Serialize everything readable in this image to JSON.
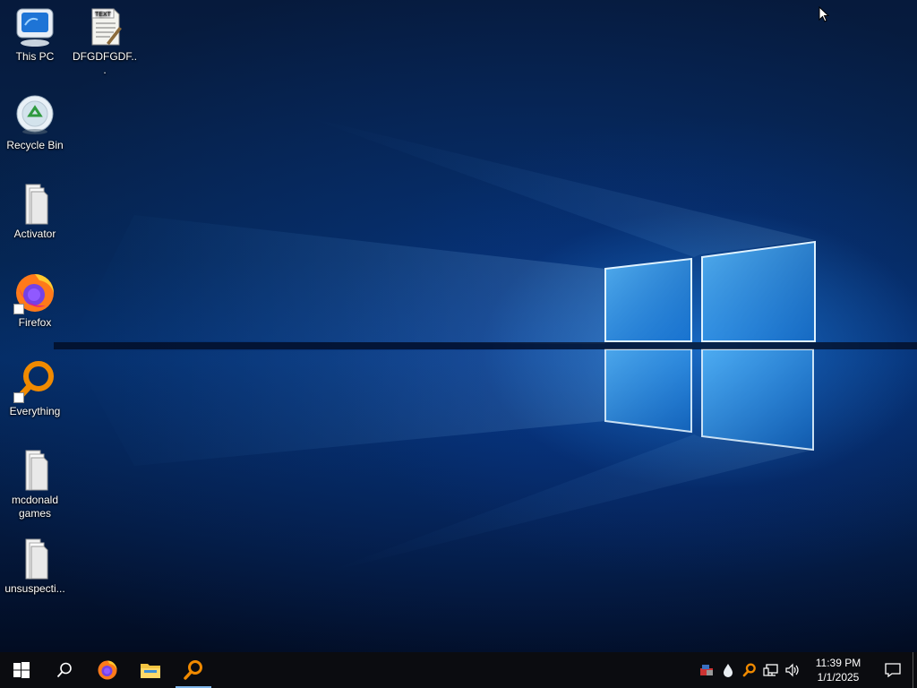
{
  "desktop": {
    "icons": [
      {
        "label": "This PC",
        "icon": "computer-icon"
      },
      {
        "label": "DFGDFGDF...",
        "icon": "text-document-icon",
        "badge": "TEXT"
      },
      {
        "label": "Recycle Bin",
        "icon": "recycle-bin-icon"
      },
      {
        "label": "Activator",
        "icon": "folder-icon"
      },
      {
        "label": "Firefox",
        "icon": "firefox-icon"
      },
      {
        "label": "Everything",
        "icon": "everything-search-icon"
      },
      {
        "label": "mcdonald games",
        "icon": "folder-icon"
      },
      {
        "label": "unsuspecti...",
        "icon": "folder-icon"
      }
    ]
  },
  "taskbar": {
    "pinned": [
      {
        "name": "start",
        "icon": "windows-logo-icon"
      },
      {
        "name": "search",
        "icon": "search-icon"
      },
      {
        "name": "firefox",
        "icon": "firefox-icon"
      },
      {
        "name": "file-explorer",
        "icon": "folder-icon"
      },
      {
        "name": "everything",
        "icon": "everything-search-icon",
        "active": true
      }
    ],
    "tray": {
      "icons": [
        "network-tool-icon",
        "droplet-icon",
        "everything-search-icon",
        "network-icon",
        "volume-icon"
      ],
      "time": "11:39 PM",
      "date": "1/1/2025"
    }
  },
  "colors": {
    "accent": "#7fb6ea",
    "taskbar": "#0b0c10",
    "everything_orange": "#f08a00"
  }
}
